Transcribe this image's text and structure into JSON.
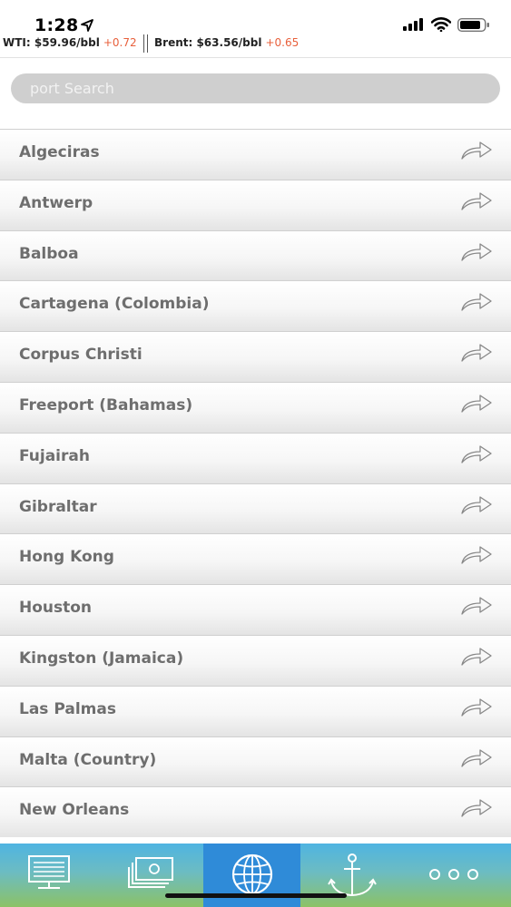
{
  "status_bar": {
    "time": "1:28",
    "icons": [
      "location-arrow-icon",
      "cellular-signal-icon",
      "wifi-icon",
      "battery-icon"
    ]
  },
  "ticker": {
    "wti_label": "WTI: $59.96/bbl",
    "wti_change": "+0.72",
    "brent_label": "Brent: $63.56/bbl",
    "brent_change": "+0.65",
    "change_color": "#e8603c"
  },
  "search": {
    "placeholder": "port Search"
  },
  "ports": [
    "Algeciras",
    "Antwerp",
    "Balboa",
    "Cartagena (Colombia)",
    "Corpus Christi",
    "Freeport (Bahamas)",
    "Fujairah",
    "Gibraltar",
    "Hong Kong",
    "Houston",
    "Kingston (Jamaica)",
    "Las Palmas",
    "Malta (Country)",
    "New Orleans"
  ],
  "tab_bar": {
    "tabs": [
      {
        "icon": "monitor-icon",
        "active": false
      },
      {
        "icon": "money-icon",
        "active": false
      },
      {
        "icon": "globe-icon",
        "active": true
      },
      {
        "icon": "anchor-icon",
        "active": false
      },
      {
        "icon": "more-icon",
        "active": false
      }
    ],
    "active_color": "#2f8bd8"
  }
}
